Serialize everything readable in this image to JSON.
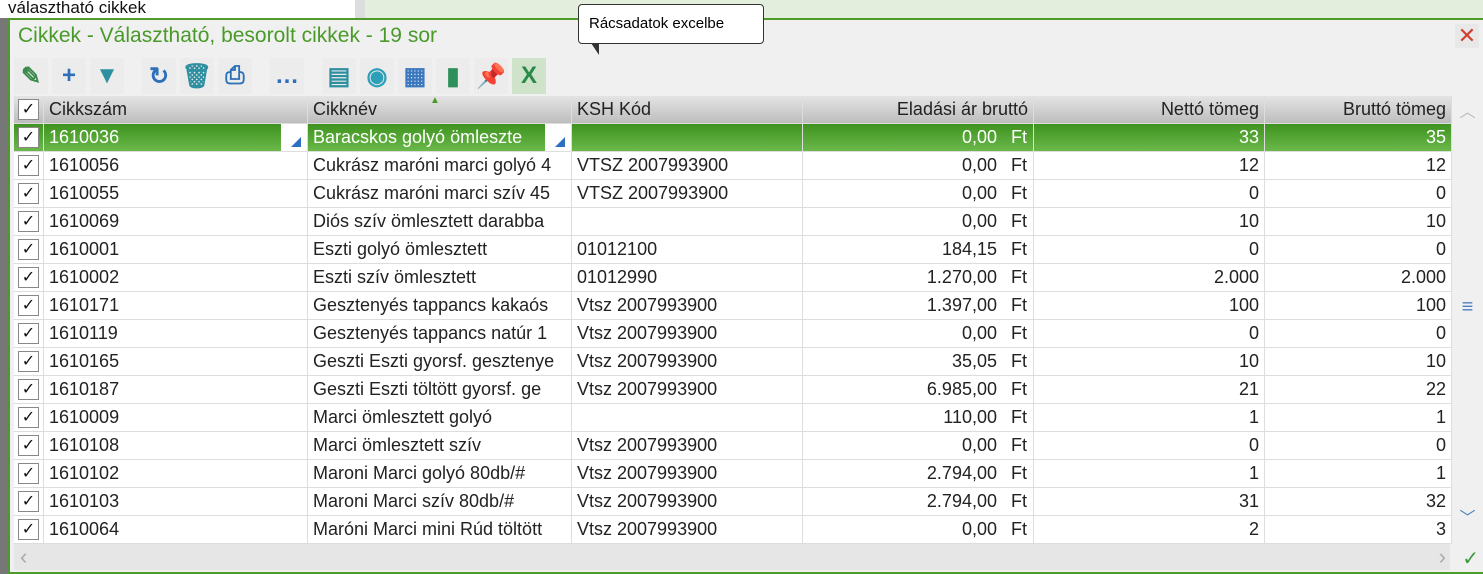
{
  "background": {
    "label": "választható cikkek"
  },
  "window": {
    "title": "Cikkek - Választható, besorolt cikkek - 19 sor",
    "close": "✕"
  },
  "tooltip": "Rácsadatok excelbe",
  "toolbar": [
    {
      "name": "edit-icon",
      "glyph": "✎",
      "color": "#3a8a4a"
    },
    {
      "name": "add-icon",
      "glyph": "+",
      "color": "#2d6fb8"
    },
    {
      "name": "filter-icon",
      "glyph": "▼",
      "color": "#2d8fa0"
    },
    {
      "name": "refresh-icon",
      "glyph": "↻",
      "color": "#2d6fb8"
    },
    {
      "name": "delete-icon",
      "glyph": "🗑",
      "color": "#2d8fa0"
    },
    {
      "name": "print-icon",
      "glyph": "⎙",
      "color": "#2d6fb8"
    },
    {
      "name": "more-icon",
      "glyph": "…",
      "color": "#2d6fb8"
    },
    {
      "name": "select-icon",
      "glyph": "▤",
      "color": "#2d8fa0"
    },
    {
      "name": "view-icon",
      "glyph": "◉",
      "color": "#2d9fb8"
    },
    {
      "name": "table-icon",
      "glyph": "▦",
      "color": "#3a78c0"
    },
    {
      "name": "chart-icon",
      "glyph": "▮",
      "color": "#2d8f5a"
    },
    {
      "name": "pin-icon",
      "glyph": "📌",
      "color": "#3a9a6a"
    },
    {
      "name": "excel-icon",
      "glyph": "X",
      "color": "#2a8a4a"
    }
  ],
  "columns": [
    "Cikkszám",
    "Cikknév",
    "KSH Kód",
    "Eladási ár bruttó",
    "Nettó tömeg",
    "Bruttó tömeg"
  ],
  "currency": "Ft",
  "rows": [
    [
      "1610036",
      "Baracskos golyó ömleszte",
      "",
      "0,00",
      "33",
      "35"
    ],
    [
      "1610056",
      "Cukrász maróni marci golyó 4",
      "VTSZ 2007993900",
      "0,00",
      "12",
      "12"
    ],
    [
      "1610055",
      "Cukrász maróni marci szív 45",
      "VTSZ 2007993900",
      "0,00",
      "0",
      "0"
    ],
    [
      "1610069",
      "Diós szív ömlesztett darabba",
      "",
      "0,00",
      "10",
      "10"
    ],
    [
      "1610001",
      "Eszti golyó ömlesztett",
      "01012100",
      "184,15",
      "0",
      "0"
    ],
    [
      "1610002",
      "Eszti szív ömlesztett",
      "01012990",
      "1.270,00",
      "2.000",
      "2.000"
    ],
    [
      "1610171",
      "Gesztenyés tappancs kakaós",
      "Vtsz 2007993900",
      "1.397,00",
      "100",
      "100"
    ],
    [
      "1610119",
      "Gesztenyés tappancs natúr 1",
      "Vtsz 2007993900",
      "0,00",
      "0",
      "0"
    ],
    [
      "1610165",
      "Geszti Eszti gyorsf. gesztenye",
      "Vtsz 2007993900",
      "35,05",
      "10",
      "10"
    ],
    [
      "1610187",
      "Geszti Eszti töltött gyorsf. ge",
      "Vtsz 2007993900",
      "6.985,00",
      "21",
      "22"
    ],
    [
      "1610009",
      "Marci ömlesztett golyó",
      "",
      "110,00",
      "1",
      "1"
    ],
    [
      "1610108",
      "Marci ömlesztett szív",
      "Vtsz 2007993900",
      "0,00",
      "0",
      "0"
    ],
    [
      "1610102",
      "Maroni Marci golyó 80db/#",
      "Vtsz 2007993900",
      "2.794,00",
      "1",
      "1"
    ],
    [
      "1610103",
      "Maroni Marci szív 80db/#",
      "Vtsz 2007993900",
      "2.794,00",
      "31",
      "32"
    ],
    [
      "1610064",
      "Maróni Marci mini Rúd töltött",
      "Vtsz 2007993900",
      "0,00",
      "2",
      "3"
    ]
  ]
}
